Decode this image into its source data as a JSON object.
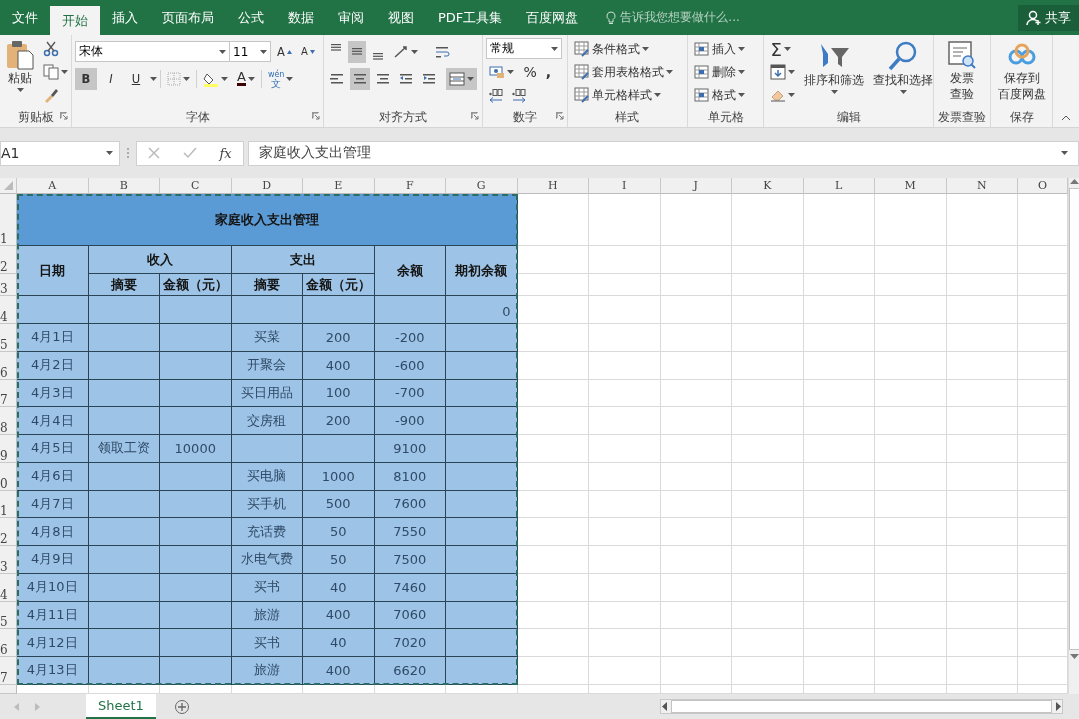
{
  "tabs": [
    {
      "label": "文件",
      "selected": false
    },
    {
      "label": "开始",
      "selected": true
    },
    {
      "label": "插入",
      "selected": false
    },
    {
      "label": "页面布局",
      "selected": false
    },
    {
      "label": "公式",
      "selected": false
    },
    {
      "label": "数据",
      "selected": false
    },
    {
      "label": "审阅",
      "selected": false
    },
    {
      "label": "视图",
      "selected": false
    },
    {
      "label": "PDF工具集",
      "selected": false
    },
    {
      "label": "百度网盘",
      "selected": false
    }
  ],
  "tell_me": {
    "placeholder": "告诉我您想要做什么..."
  },
  "share": "共享",
  "ribbon": {
    "clipboard": {
      "paste": "粘贴",
      "label": "剪贴板"
    },
    "font": {
      "font_name": "宋体",
      "font_size": "11",
      "grow": "A",
      "shrink": "A",
      "styles": [
        {
          "text": "B",
          "selected": true
        },
        {
          "text": "I",
          "selected": false
        },
        {
          "text": "U",
          "selected": false
        }
      ],
      "font_color": "A",
      "phonetic_top": "wén",
      "phonetic_bottom": "文",
      "label": "字体"
    },
    "alignment": {
      "vertical": [
        {
          "selected": false
        },
        {
          "selected": true
        },
        {
          "selected": false
        }
      ],
      "horizontal": [
        {
          "selected": false
        },
        {
          "selected": true
        },
        {
          "selected": false
        }
      ],
      "merge": {
        "selected": true
      },
      "label": "对齐方式"
    },
    "number": {
      "format": "常规",
      "percent": "%",
      "comma": ",",
      "label": "数字"
    },
    "styles": {
      "items": [
        "条件格式",
        "套用表格格式",
        "单元格样式"
      ],
      "label": "样式"
    },
    "cells": {
      "items": [
        "插入",
        "删除",
        "格式"
      ],
      "label": "单元格"
    },
    "editing": {
      "sum": "Σ",
      "sort": "排序和筛选",
      "find": "查找和选择",
      "label": "编辑"
    },
    "invoice": {
      "lines": [
        "发票",
        "查验"
      ],
      "label": "发票查验"
    },
    "save": {
      "lines": [
        "保存到",
        "百度网盘"
      ],
      "label": "保存"
    }
  },
  "formula_bar": {
    "name_box": "A1",
    "fx": "fx",
    "value": "家庭收入支出管理"
  },
  "sheet": {
    "columns": [
      "A",
      "B",
      "C",
      "D",
      "E",
      "F",
      "G",
      "H",
      "I",
      "J",
      "K",
      "L",
      "M",
      "N",
      "O"
    ],
    "row_numbers": [
      "1",
      "2",
      "3",
      "4",
      "5",
      "6",
      "7",
      "8",
      "9",
      "0",
      "1",
      "2",
      "3",
      "4",
      "5",
      "6",
      "7"
    ],
    "title": "家庭收入支出管理",
    "header": {
      "date": "日期",
      "income": {
        "label": "收入",
        "columns": [
          "摘要",
          "金额（元）"
        ]
      },
      "expense": {
        "label": "支出",
        "columns": [
          "摘要",
          "金额（元）"
        ]
      },
      "balance": "余额",
      "opening_balance": "期初余额"
    },
    "rows": [
      {
        "opening_balance": "0"
      },
      {
        "date": "4月1日",
        "expense_item": "买菜",
        "expense_amount": "200",
        "balance": "-200"
      },
      {
        "date": "4月2日",
        "expense_item": "开聚会",
        "expense_amount": "400",
        "balance": "-600"
      },
      {
        "date": "4月3日",
        "expense_item": "买日用品",
        "expense_amount": "100",
        "balance": "-700"
      },
      {
        "date": "4月4日",
        "expense_item": "交房租",
        "expense_amount": "200",
        "balance": "-900"
      },
      {
        "date": "4月5日",
        "income_item": "领取工资",
        "income_amount": "10000",
        "balance": "9100"
      },
      {
        "date": "4月6日",
        "expense_item": "买电脑",
        "expense_amount": "1000",
        "balance": "8100"
      },
      {
        "date": "4月7日",
        "expense_item": "买手机",
        "expense_amount": "500",
        "balance": "7600"
      },
      {
        "date": "4月8日",
        "expense_item": "充话费",
        "expense_amount": "50",
        "balance": "7550"
      },
      {
        "date": "4月9日",
        "expense_item": "水电气费",
        "expense_amount": "50",
        "balance": "7500"
      },
      {
        "date": "4月10日",
        "expense_item": "买书",
        "expense_amount": "40",
        "balance": "7460"
      },
      {
        "date": "4月11日",
        "expense_item": "旅游",
        "expense_amount": "400",
        "balance": "7060"
      },
      {
        "date": "4月12日",
        "expense_item": "买书",
        "expense_amount": "40",
        "balance": "7020"
      },
      {
        "date": "4月13日",
        "expense_item": "旅游",
        "expense_amount": "400",
        "balance": "6620"
      }
    ]
  },
  "sheet_tabs": [
    {
      "label": "Sheet1",
      "selected": true
    }
  ]
}
